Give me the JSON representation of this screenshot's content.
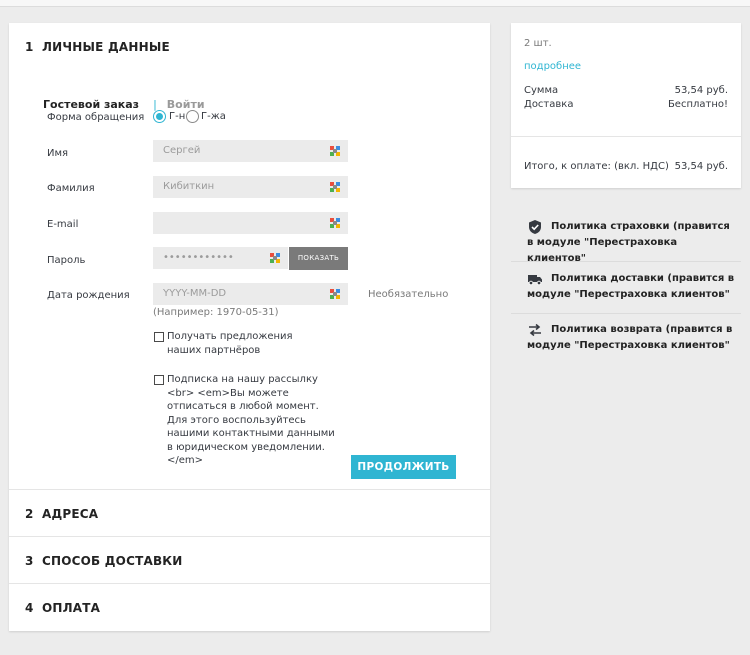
{
  "steps": [
    {
      "num": "1",
      "title": "ЛИЧНЫЕ ДАННЫЕ"
    },
    {
      "num": "2",
      "title": "АДРЕСА"
    },
    {
      "num": "3",
      "title": "СПОСОБ ДОСТАВКИ"
    },
    {
      "num": "4",
      "title": "ОПЛАТА"
    }
  ],
  "tabs": {
    "guest": "Гостевой заказ",
    "separator": "|",
    "login": "Войти"
  },
  "form": {
    "salutation_label": "Форма обращения",
    "salutation_options": [
      "Г-н",
      "Г-жа"
    ],
    "salutation_selected": "Г-н",
    "first_name_label": "Имя",
    "first_name_value": "Сергей",
    "last_name_label": "Фамилия",
    "last_name_value": "Кибиткин",
    "email_label": "E-mail",
    "email_value": "",
    "password_label": "Пароль",
    "password_value": "••••••••••••",
    "show_button": "ПОКАЗАТЬ",
    "birthday_label": "Дата рождения",
    "birthday_placeholder": "YYYY-MM-DD",
    "birthday_optional": "Необязательно",
    "birthday_hint": "(Например: 1970-05-31)",
    "partner_offers": "Получать предложения наших партнёров",
    "partner_offers_checked": false,
    "newsletter": "Подписка на нашу рассылку <br> <em>Вы можете отписаться в любой момент. Для этого воспользуйтесь нашими контактными данными в юридическом уведомлении.</em>",
    "newsletter_checked": false,
    "continue_button": "ПРОДОЛЖИТЬ"
  },
  "summary": {
    "count": "2 шт.",
    "details_link": "подробнее",
    "subtotal_label": "Сумма",
    "subtotal_value": "53,54 руб.",
    "shipping_label": "Доставка",
    "shipping_value": "Бесплатно!",
    "total_label": "Итого, к оплате: (вкл. НДС)",
    "total_value": "53,54 руб."
  },
  "reassurance": [
    {
      "icon": "shield-icon",
      "text": "Политика страховки (правится в модуле \"Перестраховка клиентов\""
    },
    {
      "icon": "truck-icon",
      "text": "Политика доставки (правится в модуле \"Перестраховка клиентов\""
    },
    {
      "icon": "swap-arrows-icon",
      "text": "Политика возврата (правится в модуле \"Перестраховка клиентов\""
    }
  ],
  "colors": {
    "accent": "#2fb5d2",
    "button_gray": "#7a7a7a",
    "field_bg": "#ebebeb"
  }
}
